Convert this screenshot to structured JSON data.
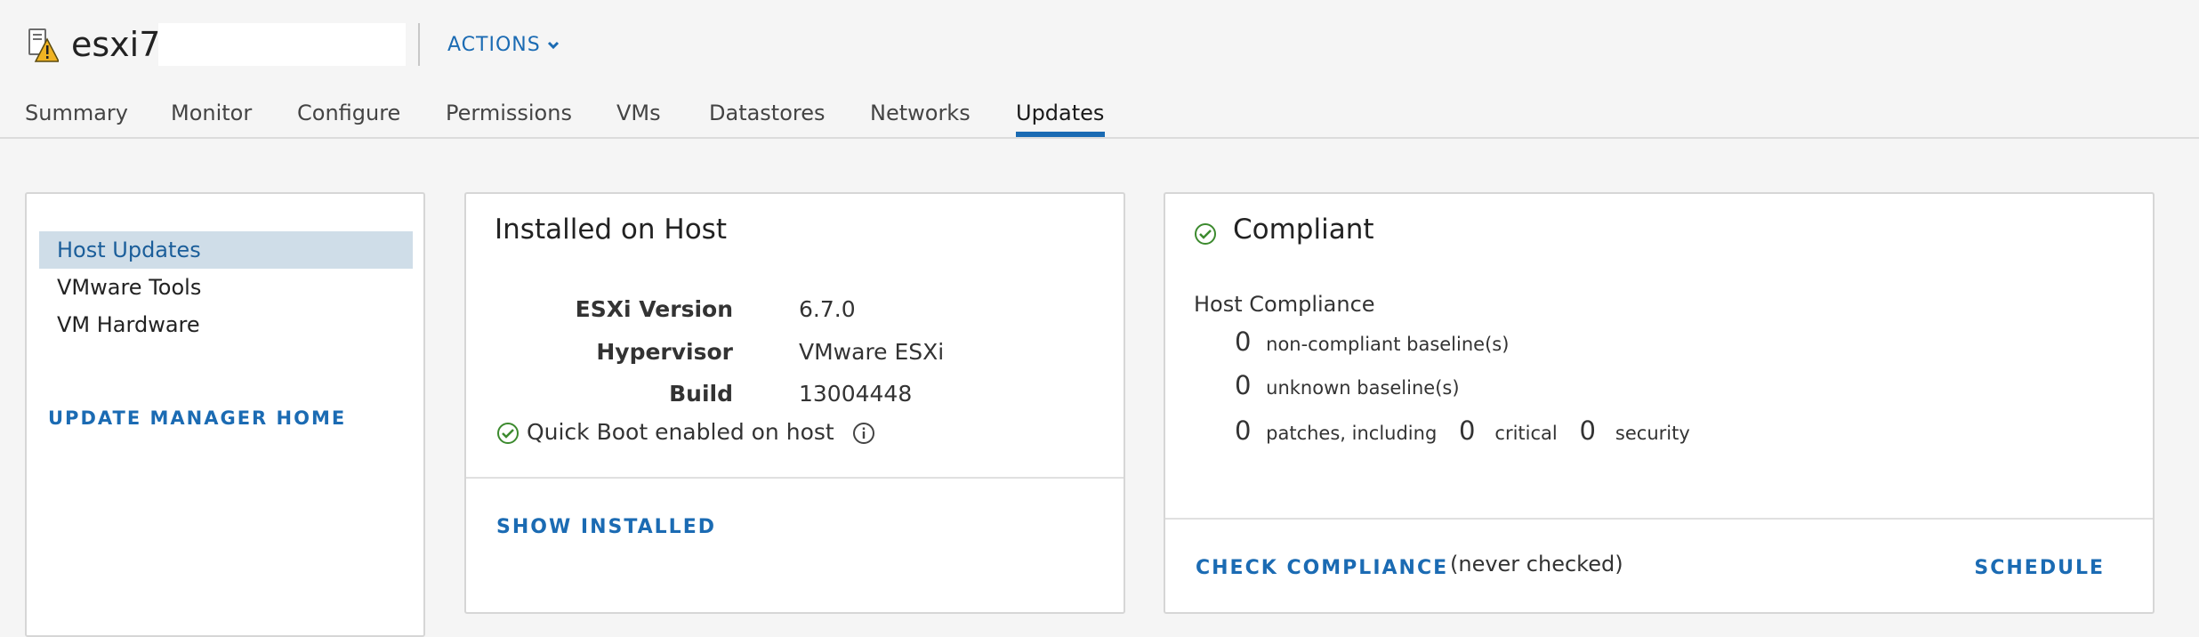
{
  "host": {
    "name": "esxi7",
    "icon": "host-warning-icon"
  },
  "actions_label": "ACTIONS",
  "tabs": [
    {
      "label": "Summary"
    },
    {
      "label": "Monitor"
    },
    {
      "label": "Configure"
    },
    {
      "label": "Permissions"
    },
    {
      "label": "VMs"
    },
    {
      "label": "Datastores"
    },
    {
      "label": "Networks"
    },
    {
      "label": "Updates",
      "active": true
    }
  ],
  "nav": {
    "items": [
      {
        "label": "Host Updates",
        "active": true
      },
      {
        "label": "VMware Tools"
      },
      {
        "label": "VM Hardware"
      }
    ],
    "home_link": "UPDATE MANAGER HOME"
  },
  "installed": {
    "title": "Installed on Host",
    "props": [
      {
        "label": "ESXi Version",
        "value": "6.7.0"
      },
      {
        "label": "Hypervisor",
        "value": "VMware ESXi"
      },
      {
        "label": "Build",
        "value": "13004448"
      }
    ],
    "quick_boot": "Quick Boot enabled on host",
    "show_installed": "SHOW INSTALLED"
  },
  "compliance": {
    "title": "Compliant",
    "host_compliance_label": "Host Compliance",
    "non_compliant_count": "0",
    "non_compliant_label": "non-compliant baseline(s)",
    "unknown_count": "0",
    "unknown_label": "unknown baseline(s)",
    "patches_count": "0",
    "patches_label": "patches, including",
    "critical_count": "0",
    "critical_label": "critical",
    "security_count": "0",
    "security_label": "security",
    "check_label": "CHECK COMPLIANCE",
    "never_checked": "(never checked)",
    "schedule_label": "SCHEDULE"
  },
  "colors": {
    "accent": "#1b6bb3",
    "ok": "#3c8a2e",
    "warning": "#f0b323",
    "nav_active_bg": "#cfdde8"
  }
}
